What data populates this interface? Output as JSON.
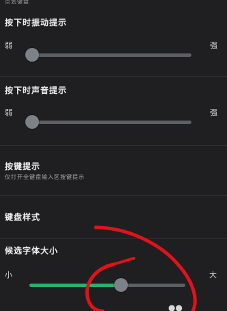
{
  "top_fragment": "点划键盘",
  "vibration": {
    "title": "按下时振动提示",
    "min_label": "弱",
    "max_label": "强",
    "value_fraction": 0.0
  },
  "sound": {
    "title": "按下时声音提示",
    "min_label": "弱",
    "max_label": "强",
    "value_fraction": 0.0
  },
  "key_hint": {
    "title": "按键提示",
    "subtitle": "仅打开全键盘输入区按键提示"
  },
  "keyboard_style": {
    "title": "键盘样式"
  },
  "candidate_font_size": {
    "title": "候选字体大小",
    "min_label": "小",
    "max_label": "大",
    "value_fraction": 0.6
  },
  "colors": {
    "background": "#1f1f21",
    "track": "#5d5f62",
    "accent": "#24b36b",
    "thumb": "#7c8287",
    "annotation": "#e1121a"
  },
  "icons": {
    "corner_icon": "double-drop-icon"
  }
}
